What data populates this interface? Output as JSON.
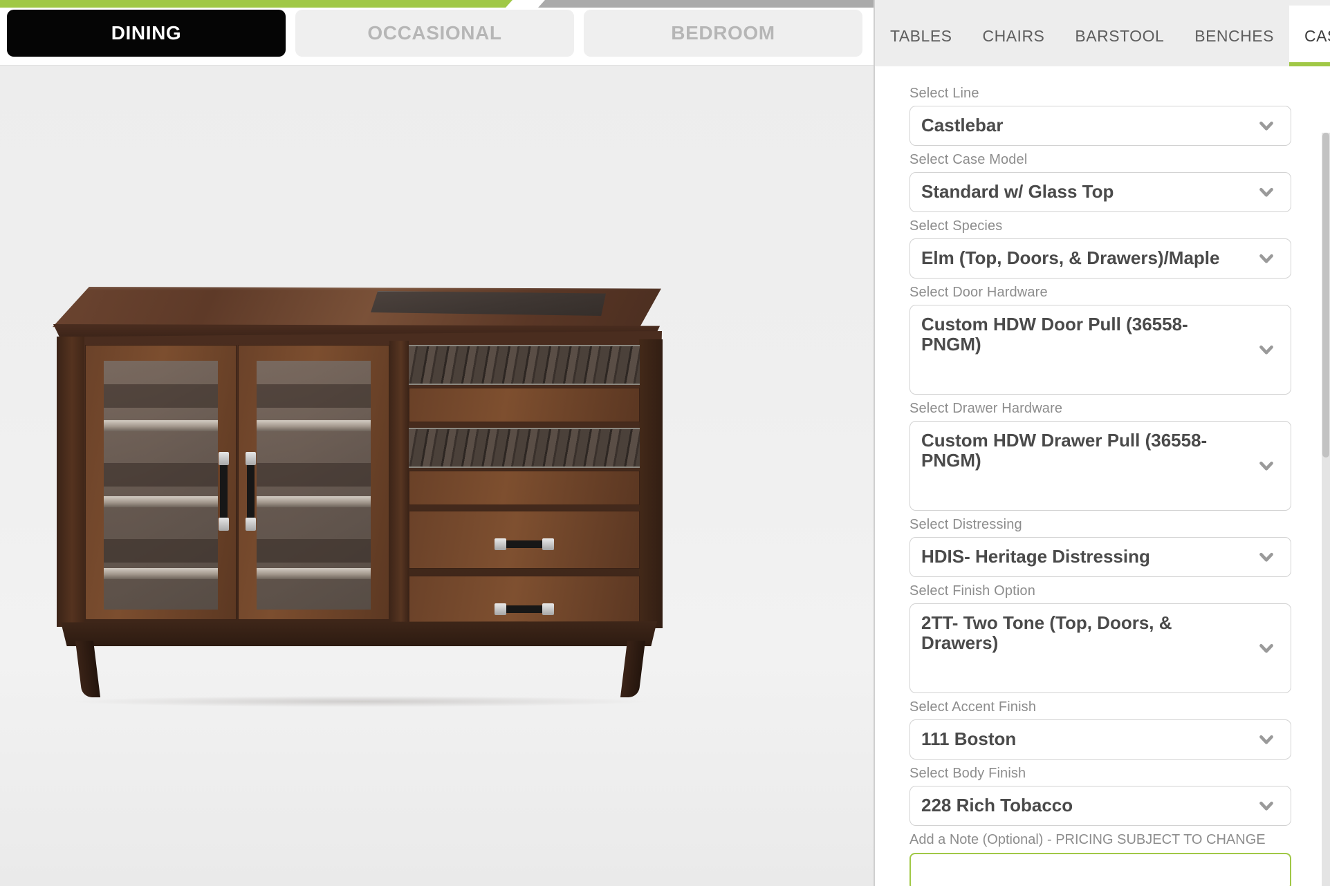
{
  "theme": {
    "accent_green": "#A0C846",
    "accent_gray": "#AAAAAA",
    "active_tab_bg": "#050505",
    "inactive_tab_bg": "#EFEFEF",
    "inactive_tab_text": "#B6B6B6",
    "label_gray": "#8D8D8D",
    "value_gray": "#4A4A4A"
  },
  "category_tabs": [
    {
      "label": "DINING",
      "active": true
    },
    {
      "label": "OCCASIONAL",
      "active": false
    },
    {
      "label": "BEDROOM",
      "active": false
    }
  ],
  "product_tabs": [
    {
      "label": "TABLES",
      "active": false
    },
    {
      "label": "CHAIRS",
      "active": false
    },
    {
      "label": "BARSTOOL",
      "active": false
    },
    {
      "label": "BENCHES",
      "active": false
    },
    {
      "label": "CASES",
      "active": true
    }
  ],
  "viewer": {
    "product_name": "glass-top case / sideboard",
    "description": "3D rendered two-tone wood case with two glass doors, two wine racks, two drawers and flared legs"
  },
  "configurator": {
    "fields": [
      {
        "label": "Select Line",
        "value": "Castlebar",
        "tall": false
      },
      {
        "label": "Select Case Model",
        "value": "Standard w/ Glass Top",
        "tall": false
      },
      {
        "label": "Select Species",
        "value": "Elm (Top, Doors, & Drawers)/Maple",
        "tall": false
      },
      {
        "label": "Select Door Hardware",
        "value": "Custom HDW Door Pull (36558-PNGM)",
        "tall": true
      },
      {
        "label": "Select Drawer Hardware",
        "value": "Custom HDW Drawer Pull (36558-PNGM)",
        "tall": true
      },
      {
        "label": "Select Distressing",
        "value": "HDIS- Heritage Distressing",
        "tall": false
      },
      {
        "label": "Select Finish Option",
        "value": "2TT- Two Tone (Top, Doors, & Drawers)",
        "tall": true
      },
      {
        "label": "Select Accent Finish",
        "value": "111 Boston",
        "tall": false
      },
      {
        "label": "Select Body Finish",
        "value": "228 Rich Tobacco",
        "tall": false
      }
    ],
    "note": {
      "label": "Add a Note (Optional) - PRICING SUBJECT TO CHANGE",
      "value": "",
      "placeholder": ""
    }
  }
}
